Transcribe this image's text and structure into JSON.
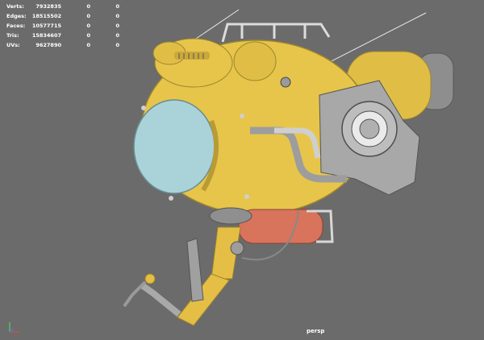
{
  "hud": {
    "rows": [
      {
        "label": "Verts:",
        "v1": "7932835",
        "v2": "0",
        "v3": "0"
      },
      {
        "label": "Edges:",
        "v1": "18515502",
        "v2": "0",
        "v3": "0"
      },
      {
        "label": "Faces:",
        "v1": "10577715",
        "v2": "0",
        "v3": "0"
      },
      {
        "label": "Tris:",
        "v1": "15834607",
        "v2": "0",
        "v3": "0"
      },
      {
        "label": "UVs:",
        "v1": "9627890",
        "v2": "0",
        "v3": "0"
      }
    ]
  },
  "viewport": {
    "camera_label": "persp",
    "background_color": "#6b6b6b"
  },
  "model": {
    "body_color": "#e6c54a",
    "dome_color": "#a9d3d8",
    "engine_color": "#a8a8a8",
    "tank_color": "#d8735c",
    "arm_color": "#e5bf45"
  },
  "axis_gizmo": {
    "x_color": "#d94a4a",
    "y_color": "#57c15a",
    "z_color": "#4a7ad9"
  }
}
